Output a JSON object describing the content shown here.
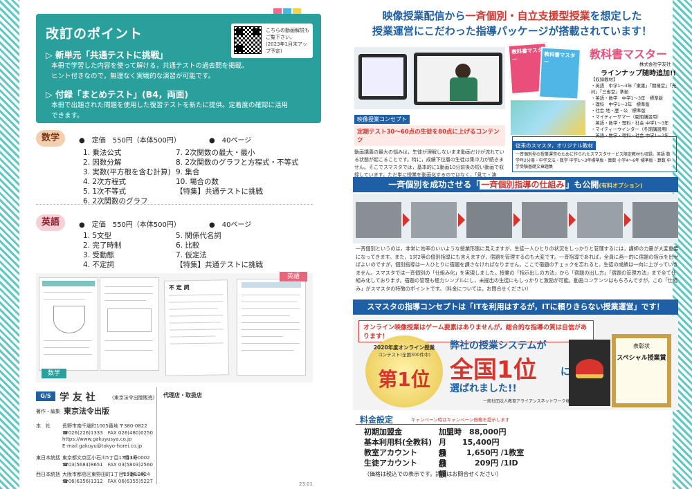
{
  "left": {
    "kaitei": {
      "title": "改訂のポイント",
      "point1_title": "▷ 新単元「共通テストに挑戦」",
      "point1_text1": "本冊で学習した内容を使って解ける，共通テストの過去問を掲載。",
      "point1_text2": "ヒント付きなので，無理なく実戦的な演習が可能です。",
      "point2_title": "▷ 付録「まとめテスト」(B4，両面)",
      "point2_text1": "本冊で出題された問題を使用した復習テストを新たに提供。定着度の確認に活用",
      "point2_text2": "できます。",
      "qr_text1": "こちらの動画解説も",
      "qr_text2": "ご覧下さい。",
      "qr_text3": "(2023年1月末アップ予定)"
    },
    "math": {
      "badge": "数学",
      "price": "●　定価　550円（本体500円）",
      "pages": "●　40ページ",
      "items_left": [
        "1. 乗法公式",
        "2. 因数分解",
        "3. 実数(平方根を含む計算)",
        "4. 2次方程式",
        "5. 1次不等式",
        "6. 2次関数のグラフ"
      ],
      "items_right": [
        "7. 2次関数の最大・最小",
        "8. 2次関数のグラフと方程式・不等式",
        "9. 集合",
        "10. 場合の数",
        "【特集】共通テストに挑戦"
      ]
    },
    "english": {
      "badge": "英語",
      "price": "●　定価　550円（本体500円）",
      "pages": "●　40ページ",
      "items_left": [
        "1. 5文型",
        "2. 完了時制",
        "3. 受動態",
        "4. 不定詞"
      ],
      "items_right": [
        "5. 関係代名詞",
        "6. 比較",
        "7. 仮定法",
        "【特集】共通テストに挑戦"
      ]
    },
    "samples": {
      "math_label": "数学",
      "english_label": "英語",
      "eng_title": "不 定 詞"
    },
    "footer": {
      "logo_text": "学 友 社",
      "publisher_note": "(東京法令出版販売)",
      "agent_label": "代理店・取扱店",
      "editor_label": "著作・編集",
      "editor_name": "東京法令出版",
      "rows": [
        {
          "label": "本　社",
          "l1": "長野市南千歳町1005番地",
          "l2": "☎026(226)1333　FAX 026(480)0250",
          "l3": "https://www.gakuyusya.co.jp",
          "l4": "E-mail gakuyu@tokyo-horei.co.jp",
          "zip": "〒380-0822"
        },
        {
          "label": "東日本統括",
          "l1": "東京都文京区小石川5丁目17番3号",
          "l2": "☎03(5684)8651　FAX 03(5803)2560",
          "l3": "",
          "l4": "",
          "zip": "〒112-0002"
        },
        {
          "label": "西日本統括",
          "l1": "大阪市都島区東野田町1丁目17番12号",
          "l2": "☎06(6356)1312　FAX 06(6355)5227",
          "l3": "",
          "l4": "",
          "zip": "〒534-0024"
        }
      ],
      "code": "23.01"
    }
  },
  "right": {
    "headline1a": "映像授業配信から",
    "headline1b": "一斉個別・自立支援型授業",
    "headline1c": "を想定した",
    "headline2": "授業運営にこだわった指導パッケージが搭載されています！",
    "video_concept_label": "映像授業コンセプト",
    "video_concept_title": "定期テスト30～60点の生徒を80点に上げるコンテンツ",
    "video_text": "動画講義の最大の悩みは，生徒が理解しないまま動画だけが流れている状態が起こることです。特に，成績下位層の生徒は集中力が続きません。そこでスマスタでは，基本的に1動画10分前後の短い動画で収録しています。ただ単に授業を動画化するのではなく，「見て・演習・見て・演習」のスパンを限りなく縮め，生徒の集中力を持続させるように作り込んでいます。",
    "book": {
      "title": "教科書マスター",
      "company": "株式会社学友社",
      "lineup": "ラインナップ随時追加!!",
      "list_title": "【収録教材】",
      "list": [
        "・英語　中学1～3年「東書」「開隆堂」「光村」「三省堂」準拠",
        "・英語・数学　中学1～3年　標準版",
        "・理科　中学1～3年　標準版",
        "・社会 地・歴・公　標準版",
        "・マイティーサマー（夏期講習用）",
        "　英語・数学・理科・社会 中学1～3年",
        "・マイティーウインター（冬期講習用）",
        "　英語・数学・理科・社会 中学1～3年"
      ],
      "cover1": "教科書マスター",
      "cover2": "教科書マスター",
      "orig_title": "従来のスマスタ，オリジナル教材",
      "orig_text": "一斉個別型の授業運営のために作られたスマスタサービス限定教材も収録。英語 数学年2分冊・中学文法・数学 中学1～3年標準版・算数 小学4～6年 標準版・算数 中学受験基礎文章題集"
    },
    "banner2a": "一斉個別を成功させる「",
    "banner2b": "一斉個別指導の仕組み",
    "banner2c": "」も公開",
    "banner2d": "(有料オプション)",
    "ikko_text": "一斉個別というのは，非常に効率のいいような授業形態に見えますが，生徒一人ひとりの状況をしっかりと管理するには，講師の力量が大変重要になってきます。また，1対2等の個別指導にも言えますが，宿題を管理するのも大変です。一斉指導であれば，全員に画一的に宿題の指示を出せばよいのですが，個別指導は一人ひとりに宿題を課さなければなりません。ここで宿題のチェックを忘れると，生徒の成績は一向に上がっていきません。スマスタでは一斉個別の「仕組み化」を実現しました。授業の「指示出しの方法」から「宿題の出し方」「宿題の管理方法」まで全て仕組み化しております。宿題の管理も極力シンプルにし，未提出の生徒にもしっかりと激励が可能。動画コンテンツはもちろんですが，この「仕組み」がスマスタの特徴のポイントです。（料金については，お問合せください）",
    "banner3": "スマスタの指導コンセプトは「ITを利用はするが，ITに頼りきらない授業運営」です！",
    "award_sub": "オンライン映像授業はゲーム要素はありませんが，総合的な指導の質は自信があります！",
    "award_year": "2020年度オンライン授業",
    "award_contest": "コンテスト(全国300件中)",
    "award_no1": "第1位",
    "award_line1": "弊社の授業システムが",
    "award_big": "全国1位",
    "award_ni": "に",
    "award_line3": "選ばれました!!",
    "award_org": "一般社団法人教育アライアンスネットワーク様主催",
    "cert_title": "表彰状",
    "cert_name": "スペシャル授業賞",
    "price_title": "料金設定",
    "price_note": "キャンペーン時はキャンペーン価格を提示します",
    "prices": [
      {
        "label": "初期加盟金",
        "unit": "",
        "val": "加盟時　88,000円"
      },
      {
        "label": "基本利用料(全教科)",
        "unit": "月額",
        "val": "15,400円"
      },
      {
        "label": "教室アカウント",
        "unit": "月額",
        "val": "1,650円 /1教室"
      },
      {
        "label": "生徒アカウント",
        "unit": "月額",
        "val": "209円 /1ID"
      }
    ],
    "price_footer": "（価格は税込での表示です。詳細はお問合せください）"
  },
  "colors": {
    "teal": "#2aa09c",
    "blue": "#1e5fa5",
    "red": "#d8342c",
    "math_badge": "#f3cfb0",
    "eng_badge": "#f6d0d4"
  }
}
